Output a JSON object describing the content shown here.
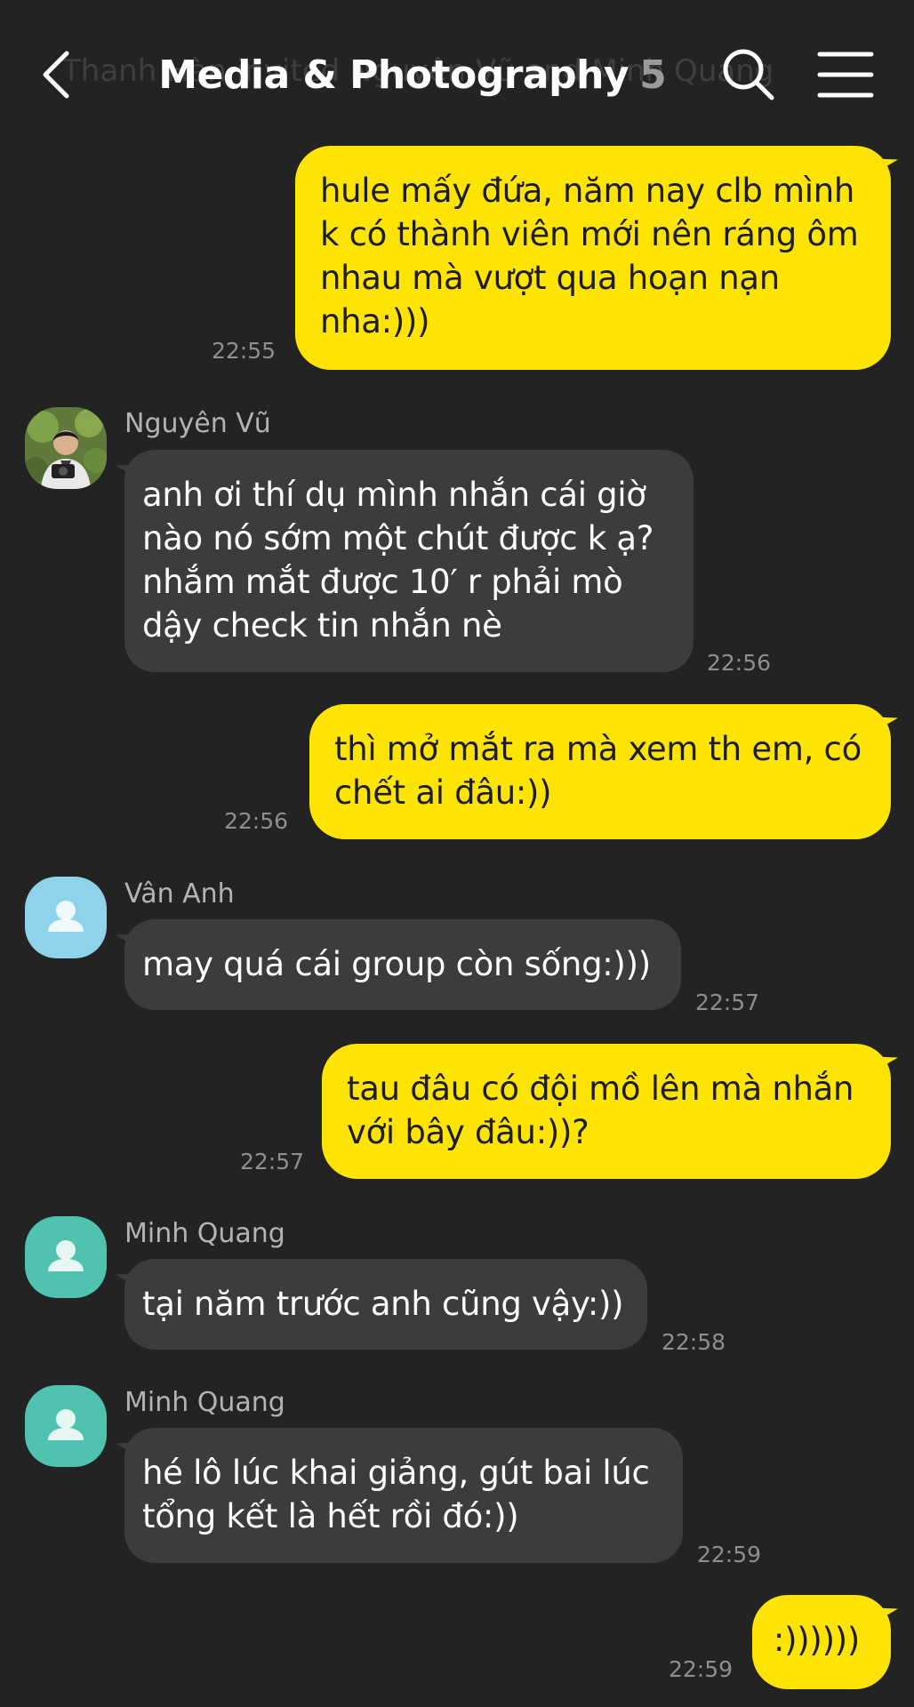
{
  "header": {
    "title": "Media & Photography",
    "member_count": "5",
    "ghost_notice": "Thanh Hàn invited Nguyên Vũ and Minh Quang"
  },
  "colors": {
    "background": "#232323",
    "outgoing_bubble": "#fde405",
    "incoming_bubble": "#3c3c3e",
    "avatar_blue": "#8fd3ea",
    "avatar_teal": "#4fc3b0"
  },
  "messages": [
    {
      "direction": "out",
      "lines": [
        "hule mấy đứa, năm nay clb mình",
        "k có thành viên mới nên ráng ôm",
        "nhau mà vượt qua hoạn nạn",
        "nha:)))"
      ],
      "time": "22:55"
    },
    {
      "direction": "in",
      "sender": "Nguyên Vũ",
      "avatar": "photo-avatar",
      "lines": [
        "anh ơi thí dụ mình nhắn cái giờ",
        "nào nó sớm một chút được k ạ?",
        "nhắm mắt được 10′ r phải mò",
        "dậy check tin nhắn nè"
      ],
      "time": "22:56"
    },
    {
      "direction": "out",
      "lines": [
        "thì mở mắt ra mà xem th em, có",
        "chết ai đâu:))"
      ],
      "time": "22:56"
    },
    {
      "direction": "in",
      "sender": "Vân Anh",
      "avatar": "default-user-icon",
      "lines": [
        "may quá cái group còn sống:)))"
      ],
      "time": "22:57"
    },
    {
      "direction": "out",
      "lines": [
        "tau đâu có đội mồ lên mà nhắn",
        "với bây đâu:))?"
      ],
      "time": "22:57"
    },
    {
      "direction": "in",
      "sender": "Minh Quang",
      "avatar": "default-user-icon",
      "lines": [
        "tại năm trước anh cũng vậy:))"
      ],
      "time": "22:58"
    },
    {
      "direction": "in",
      "sender": "Minh Quang",
      "avatar": "default-user-icon",
      "lines": [
        "hé lô lúc khai giảng, gút bai lúc",
        "tổng kết là hết rồi đó:))"
      ],
      "time": "22:59"
    },
    {
      "direction": "out",
      "lines": [
        ":))))))"
      ],
      "time": "22:59"
    }
  ]
}
